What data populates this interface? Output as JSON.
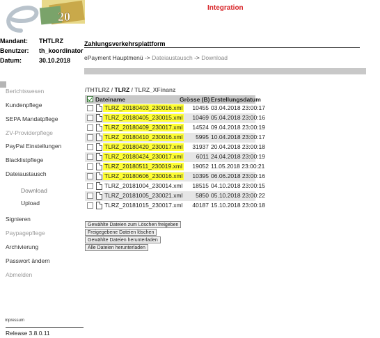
{
  "header": {
    "environment": "Integration",
    "logo_number": "20",
    "info": [
      {
        "label": "Mandant:",
        "value": "THTLRZ"
      },
      {
        "label": "Benutzer:",
        "value": "th_koordinator"
      },
      {
        "label": "Datum:",
        "value": "30.10.2018"
      }
    ],
    "platform_title": "Zahlungsverkehrsplattform",
    "breadcrumb": {
      "root": "ePayment Hauptmenü",
      "sep": " -> ",
      "mid": "Dateiaustausch",
      "last": "Download"
    }
  },
  "nav": [
    {
      "label": "Berichtswesen",
      "state": "disabled"
    },
    {
      "label": "Kundenpflege",
      "state": "active"
    },
    {
      "label": "SEPA Mandatpflege",
      "state": "active"
    },
    {
      "label": "ZV-Providerpflege",
      "state": "disabled"
    },
    {
      "label": "PayPal Einstellungen",
      "state": "active"
    },
    {
      "label": "Blacklistpflege",
      "state": "active"
    },
    {
      "label": "Dateiaustausch",
      "state": "active"
    },
    {
      "label": "Download",
      "state": "sub-current"
    },
    {
      "label": "Upload",
      "state": "sub"
    },
    {
      "label": "Signieren",
      "state": "active"
    },
    {
      "label": "Paypagepflege",
      "state": "disabled"
    },
    {
      "label": "Archivierung",
      "state": "active"
    },
    {
      "label": "Passwort ändern",
      "state": "active"
    },
    {
      "label": "Abmelden",
      "state": "disabled"
    }
  ],
  "files": {
    "path": {
      "p1": "/THTLRZ / ",
      "p2": "TLRZ",
      "p3": " / TLRZ_XFinanz"
    },
    "columns": {
      "name": "Dateiname",
      "size": "Grösse (B)",
      "date": "Erstellungsdatum"
    },
    "rows": [
      {
        "name": "TLRZ_20180403_230016.xml",
        "size": "10455",
        "date": "03.04.2018 23:00:17",
        "highlight": true
      },
      {
        "name": "TLRZ_20180405_230015.xml",
        "size": "10469",
        "date": "05.04.2018 23:00:16",
        "highlight": true
      },
      {
        "name": "TLRZ_20180409_230017.xml",
        "size": "14524",
        "date": "09.04.2018 23:00:19",
        "highlight": true
      },
      {
        "name": "TLRZ_20180410_230016.xml",
        "size": "5995",
        "date": "10.04.2018 23:00:17",
        "highlight": true
      },
      {
        "name": "TLRZ_20180420_230017.xml",
        "size": "31937",
        "date": "20.04.2018 23:00:18",
        "highlight": true
      },
      {
        "name": "TLRZ_20180424_230017.xml",
        "size": "6011",
        "date": "24.04.2018 23:00:19",
        "highlight": true
      },
      {
        "name": "TLRZ_20180511_230019.xml",
        "size": "19052",
        "date": "11.05.2018 23:00:21",
        "highlight": true
      },
      {
        "name": "TLRZ_20180606_230016.xml",
        "size": "10395",
        "date": "06.06.2018 23:00:16",
        "highlight": true
      },
      {
        "name": "TLRZ_20181004_230014.xml",
        "size": "18515",
        "date": "04.10.2018 23:00:15",
        "highlight": false
      },
      {
        "name": "TLRZ_20181005_230021.xml",
        "size": "5850",
        "date": "05.10.2018 23:00:22",
        "highlight": false
      },
      {
        "name": "TLRZ_20181015_230017.xml",
        "size": "40187",
        "date": "15.10.2018 23:00:18",
        "highlight": false
      }
    ]
  },
  "actions": [
    "Gewählte Dateien zum Löschen freigeben",
    "Freigegebene Dateien löschen",
    "Gewählte Dateien herunterladen",
    "Alle Dateien herunterladen"
  ],
  "footer": {
    "impressum": "mpressum",
    "release": "Release 3.8.0.11"
  },
  "colors": {
    "highlight": "#ffff33",
    "environment": "#d8262a",
    "bar": "#c8c8c8"
  }
}
